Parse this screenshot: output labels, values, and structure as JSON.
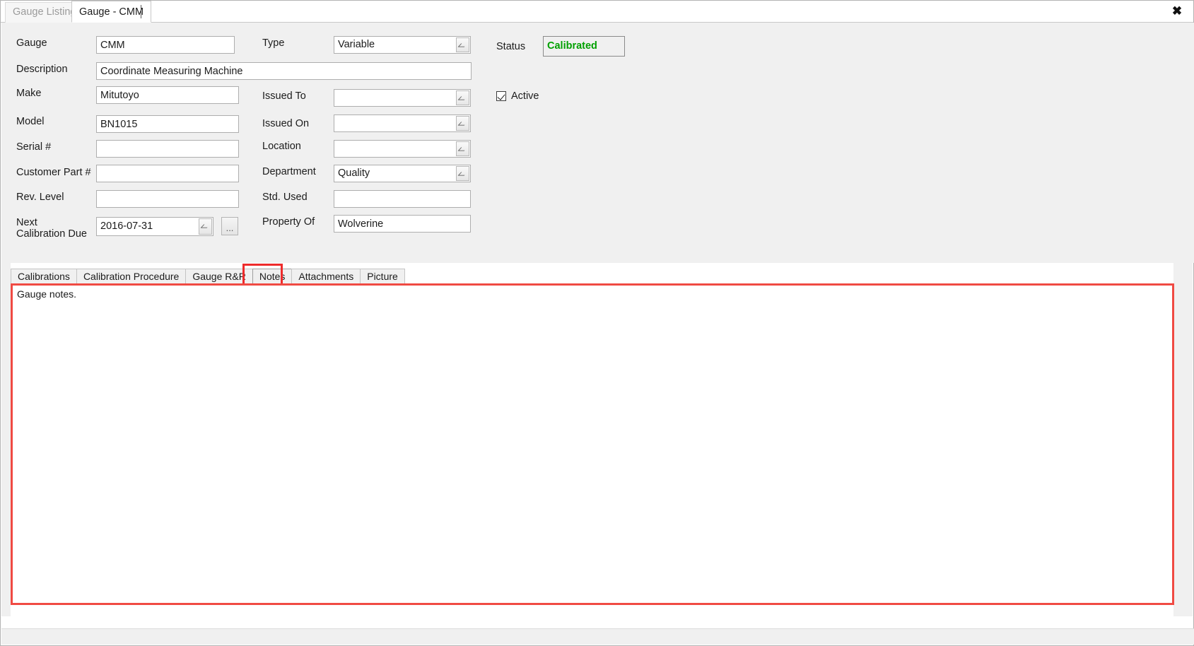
{
  "window": {
    "close_label": "✖",
    "tabs": [
      {
        "label": "Gauge Listing",
        "active": false
      },
      {
        "label": "Gauge - CMM",
        "active": true
      }
    ]
  },
  "form": {
    "left_column": [
      {
        "label": "Gauge",
        "value": "CMM"
      },
      {
        "label": "Description",
        "value": "Coordinate Measuring Machine"
      },
      {
        "label": "Make",
        "value": "Mitutoyo"
      },
      {
        "label": "Model",
        "value": "BN1015"
      },
      {
        "label": "Serial #",
        "value": ""
      },
      {
        "label": "Customer Part #",
        "value": ""
      },
      {
        "label": "Rev. Level",
        "value": ""
      }
    ],
    "next_calibration_due": {
      "label_line1": "Next",
      "label_line2": "Calibration Due",
      "value": "2016-07-31",
      "browse_button_label": "..."
    },
    "middle_column": [
      {
        "label": "Type",
        "value": "Variable",
        "control": "combo"
      },
      {
        "label": "Issued To",
        "value": "",
        "control": "combo"
      },
      {
        "label": "Issued On",
        "value": "",
        "control": "combo"
      },
      {
        "label": "Location",
        "value": "",
        "control": "combo"
      },
      {
        "label": "Department",
        "value": "Quality",
        "control": "combo"
      },
      {
        "label": "Std. Used",
        "value": "",
        "control": "text"
      },
      {
        "label": "Property Of",
        "value": "Wolverine",
        "control": "text"
      }
    ],
    "status": {
      "label": "Status",
      "value": "Calibrated",
      "value_color": "#00a000"
    },
    "active": {
      "label": "Active",
      "checked": true
    }
  },
  "bottom_tabs": {
    "items": [
      {
        "label": "Calibrations",
        "active": false
      },
      {
        "label": "Calibration Procedure",
        "active": false
      },
      {
        "label": "Gauge R&R",
        "active": false
      },
      {
        "label": "Notes",
        "active": true
      },
      {
        "label": "Attachments",
        "active": false
      },
      {
        "label": "Picture",
        "active": false
      }
    ],
    "highlight_color": "#ee2b2b"
  },
  "notes": {
    "text": "Gauge notes.",
    "placeholder": "",
    "highlight_color": "#f04a43"
  }
}
